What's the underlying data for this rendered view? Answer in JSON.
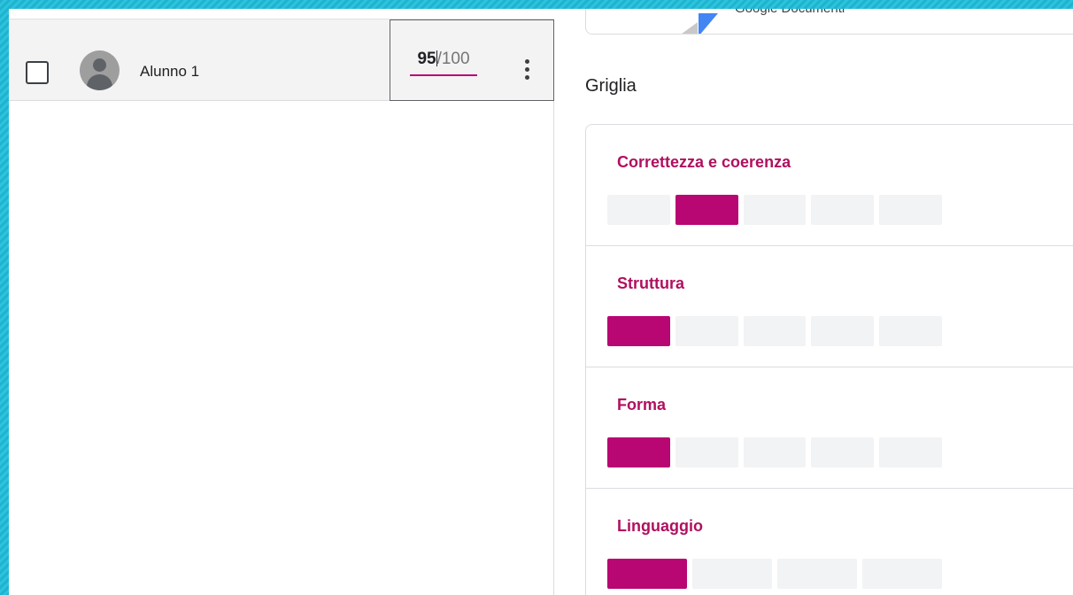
{
  "student_row": {
    "name": "Alunno 1",
    "grade_value": "95",
    "grade_total": "/100",
    "checked": false
  },
  "attachment": {
    "title": "Google Documenti"
  },
  "rubric": {
    "heading": "Griglia",
    "criteria": [
      {
        "title": "Correttezza e coerenza",
        "levels": 5,
        "selected_level": 2
      },
      {
        "title": "Struttura",
        "levels": 5,
        "selected_level": 1
      },
      {
        "title": "Forma",
        "levels": 5,
        "selected_level": 1
      },
      {
        "title": "Linguaggio",
        "levels": 4,
        "selected_level": 1
      }
    ]
  },
  "colors": {
    "accent": "#b80672",
    "criterion_title": "#b0105f",
    "level_empty": "#f1f3f4",
    "background": "#1fb3cf"
  },
  "icons": [
    "checkbox-icon",
    "avatar-icon",
    "more-vert-icon",
    "google-docs-icon"
  ]
}
